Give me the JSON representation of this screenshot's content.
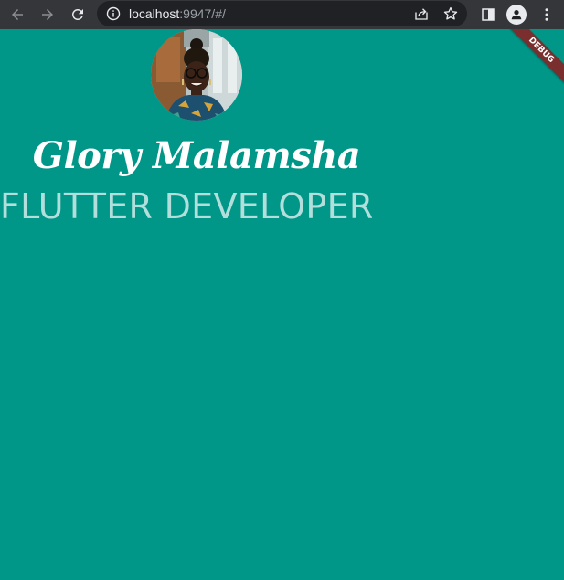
{
  "browser": {
    "url_host": "localhost",
    "url_rest": ":9947/#/",
    "icons": [
      "back-icon",
      "forward-icon",
      "reload-icon",
      "info-icon",
      "share-icon",
      "star-icon",
      "side-panel-icon",
      "profile-icon",
      "menu-icon"
    ]
  },
  "app": {
    "name": "Glory Malamsha",
    "role": "FLUTTER DEVELOPER",
    "debug_label": "DEBUG",
    "colors": {
      "background": "#009688",
      "name_text": "#ffffff",
      "role_text": "#b2dfdb",
      "debug_banner": "#7a2e2e"
    }
  }
}
